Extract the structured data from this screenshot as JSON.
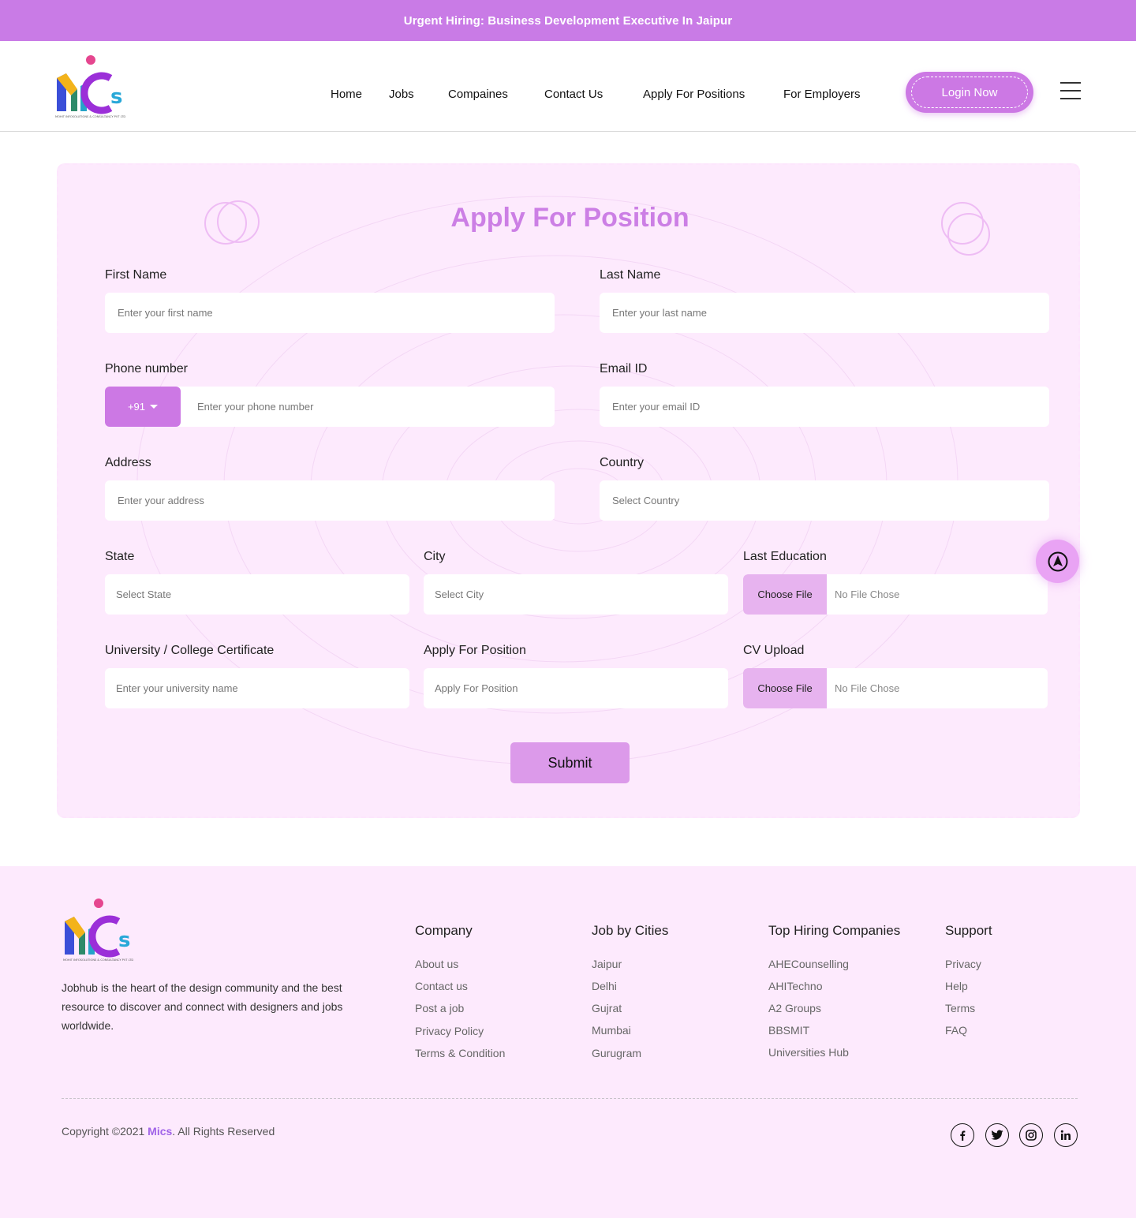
{
  "banner": {
    "text": "Urgent Hiring: Business Development Executive In Jaipur"
  },
  "logo": {
    "tagline": "MOHIT INFOSOLUTIONS & CONSULTANCY PVT LTD"
  },
  "nav": {
    "items": [
      "Home",
      "Jobs",
      "Compaines",
      "Contact Us",
      "Apply For Positions",
      "For Employers"
    ],
    "login_label": "Login Now"
  },
  "form": {
    "title": "Apply For Position",
    "first_name": {
      "label": "First Name",
      "placeholder": "Enter your first name"
    },
    "last_name": {
      "label": "Last Name",
      "placeholder": "Enter your last name"
    },
    "phone": {
      "label": "Phone number",
      "code": "+91",
      "placeholder": "Enter your phone number"
    },
    "email": {
      "label": "Email ID",
      "placeholder": "Enter your email ID"
    },
    "address": {
      "label": "Address",
      "placeholder": "Enter your address"
    },
    "country": {
      "label": "Country",
      "placeholder": "Select Country"
    },
    "state": {
      "label": "State",
      "placeholder": "Select State"
    },
    "city": {
      "label": "City",
      "placeholder": "Select City"
    },
    "last_education": {
      "label": "Last Education",
      "button": "Choose File",
      "status": "No File Chose"
    },
    "university": {
      "label": "University / College Certificate",
      "placeholder": "Enter your university name"
    },
    "apply_position": {
      "label": "Apply For Position",
      "placeholder": "Apply For Position"
    },
    "cv": {
      "label": "CV Upload",
      "button": "Choose File",
      "status": "No File Chose"
    },
    "submit_label": "Submit"
  },
  "footer": {
    "description": "Jobhub is the heart of the design community and the best resource to discover and connect with designers and jobs worldwide.",
    "columns": [
      {
        "title": "Company",
        "links": [
          "About us",
          "Contact us",
          "Post a job",
          "Privacy Policy",
          "Terms & Condition"
        ]
      },
      {
        "title": "Job by Cities",
        "links": [
          "Jaipur",
          "Delhi",
          "Gujrat",
          "Mumbai",
          "Gurugram"
        ]
      },
      {
        "title": "Top Hiring Companies",
        "links": [
          "AHECounselling",
          "AHITechno",
          "A2 Groups",
          "BBSMIT",
          "Universities Hub"
        ]
      },
      {
        "title": "Support",
        "links": [
          "Privacy",
          "Help",
          "Terms",
          "FAQ"
        ]
      }
    ],
    "copyright_prefix": "Copyright ©2021 ",
    "copyright_brand": "Mics",
    "copyright_suffix": ". All Rights Reserved",
    "social": [
      "facebook-icon",
      "twitter-icon",
      "instagram-icon",
      "linkedin-icon"
    ]
  },
  "colors": {
    "accent": "#cc78e4",
    "title": "#cc7fe5",
    "card_bg": "#fdeafd",
    "file_button": "#e7b3ef",
    "submit": "#dc9aea",
    "brand_text": "#a063e8"
  }
}
